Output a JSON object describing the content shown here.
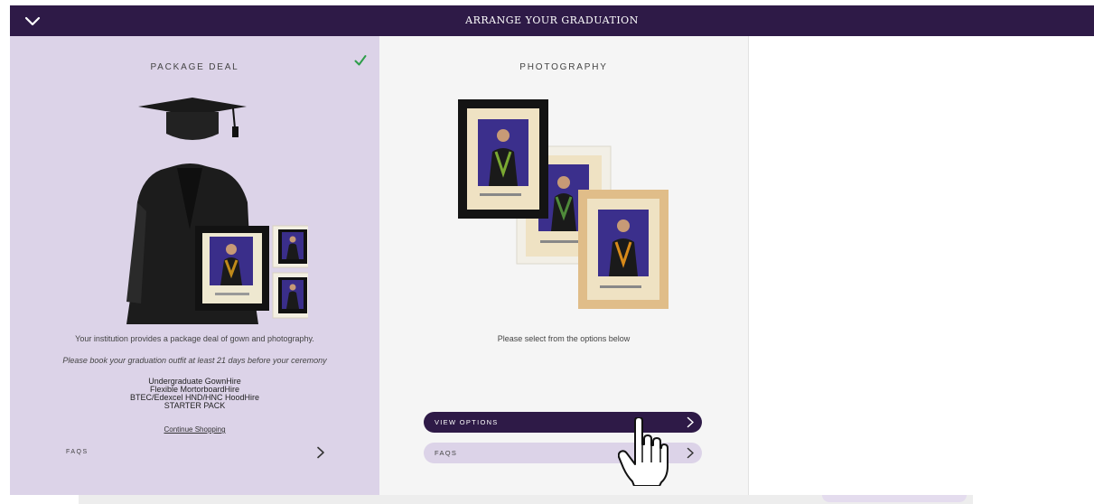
{
  "header": {
    "title": "ARRANGE YOUR GRADUATION",
    "collapse_icon": "chevron-down-icon"
  },
  "package": {
    "heading": "PACKAGE DEAL",
    "selected_icon": "checkmark-icon",
    "description": "Your institution provides a package deal of gown and photography.",
    "notice": "Please book your graduation outfit at least 21 days before your ceremony",
    "items": [
      "Undergraduate GownHire",
      "Flexible MortorboardHire",
      "BTEC/Edexcel HND/HNC HoodHire",
      "STARTER PACK"
    ],
    "continue_link": "Continue Shopping",
    "faqs_label": "FAQS"
  },
  "photography": {
    "heading": "PHOTOGRAPHY",
    "description": "Please select from the options below",
    "view_options_label": "VIEW OPTIONS",
    "faqs_label": "FAQS"
  },
  "colors": {
    "header_bg": "#2e1a47",
    "package_bg": "#dcd3e8",
    "photography_bg": "#f5f5f5",
    "check_green": "#2e9e4a"
  }
}
